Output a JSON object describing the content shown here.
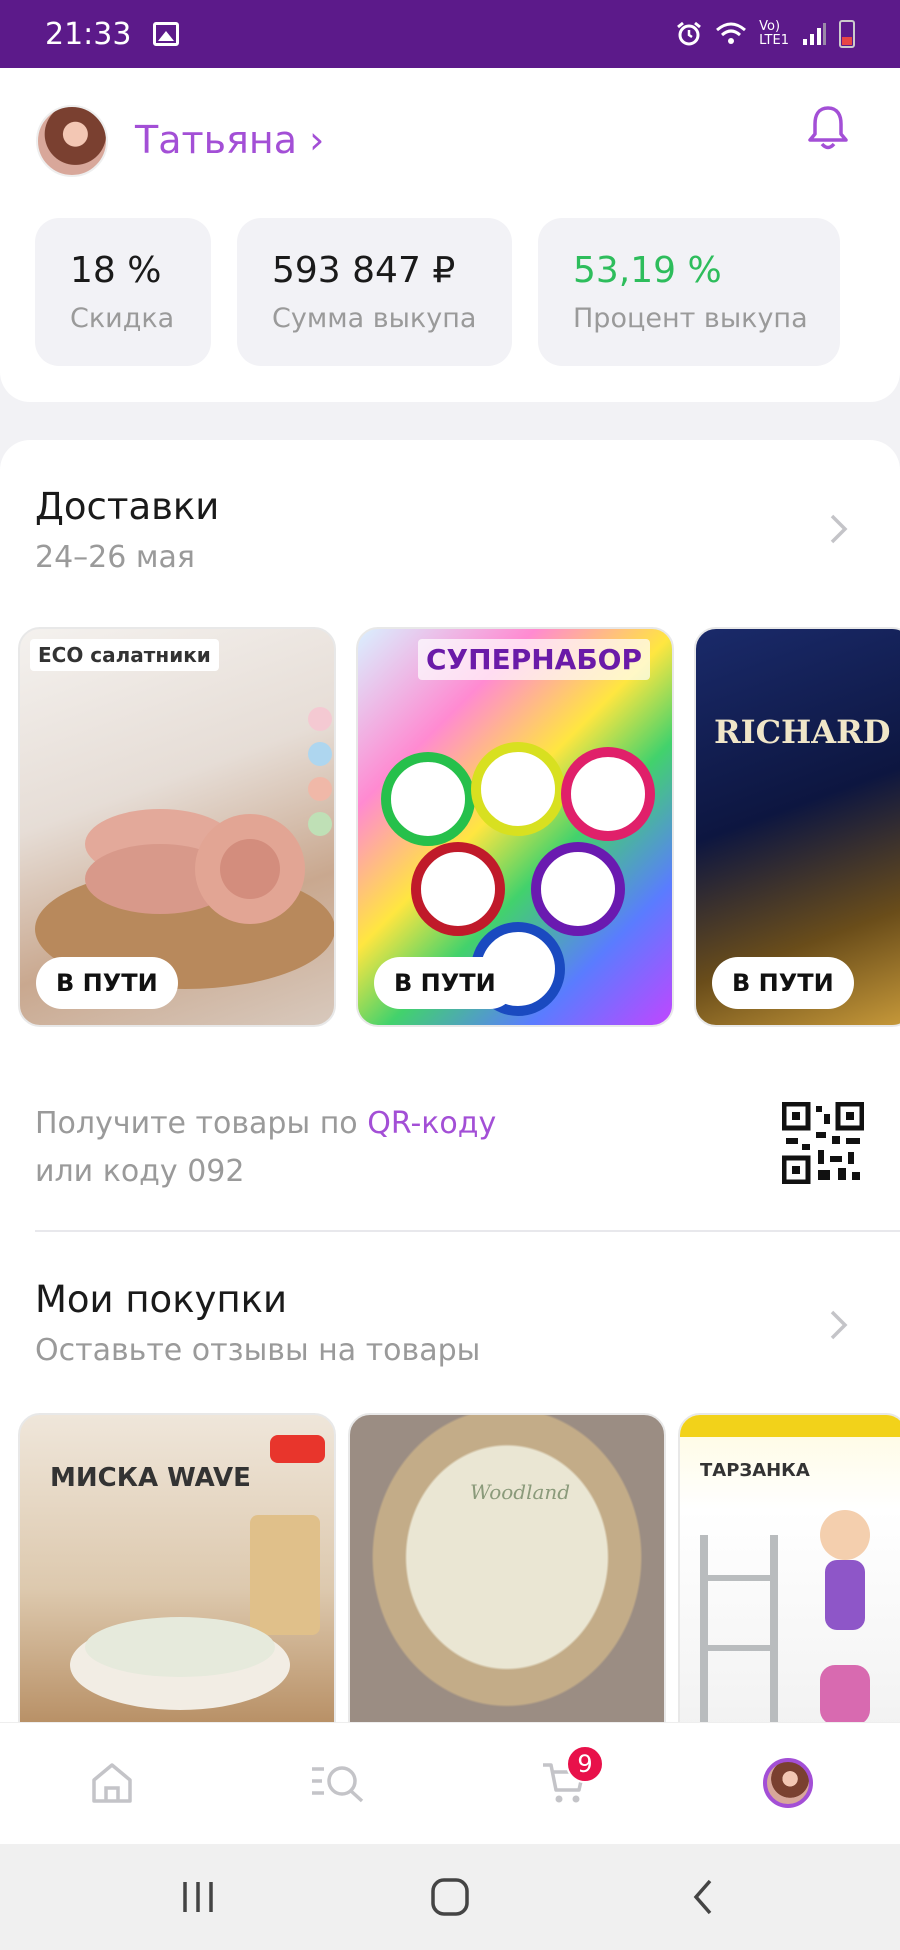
{
  "status_bar": {
    "time": "21:33",
    "network_label_top": "Vo)",
    "network_label_bottom": "LTE1"
  },
  "profile": {
    "name": "Татьяна ›",
    "stats": [
      {
        "value": "18 %",
        "label": "Скидка"
      },
      {
        "value": "593 847 ₽",
        "label": "Сумма выкупа"
      },
      {
        "value": "53,19 %",
        "label": "Процент выкупа"
      }
    ]
  },
  "deliveries": {
    "title": "Доставки",
    "date": "24–26 мая",
    "items": [
      {
        "caption": "ECO салатники",
        "status": "В ПУТИ"
      },
      {
        "caption": "СУПЕРНАБОР",
        "status": "В ПУТИ"
      },
      {
        "caption": "RICHARD",
        "status": "В ПУТИ"
      }
    ],
    "qr_text_prefix": "Получите товары по ",
    "qr_link": "QR-коду",
    "qr_text_suffix": "или коду 092"
  },
  "purchases": {
    "title": "Мои покупки",
    "subtitle": "Оставьте отзывы на товары",
    "items": [
      {
        "caption": "МИСКА WAVE"
      },
      {
        "caption": "Woodland"
      },
      {
        "caption": "ТАРЗАНКА"
      }
    ]
  },
  "bottom_nav": {
    "cart_count": "9"
  },
  "colors": {
    "status_bar": "#5c1a8a",
    "accent": "#a34fd6",
    "green": "#2ebd5c",
    "badge_red": "#e8114a"
  },
  "icons": [
    "image-icon",
    "alarm-icon",
    "wifi-icon",
    "signal-icon",
    "battery-icon",
    "bell-icon",
    "chevron-right-icon",
    "qr-code-icon",
    "home-icon",
    "catalog-search-icon",
    "cart-icon",
    "profile-avatar-icon",
    "recents-icon",
    "home-circle-icon",
    "back-icon"
  ]
}
